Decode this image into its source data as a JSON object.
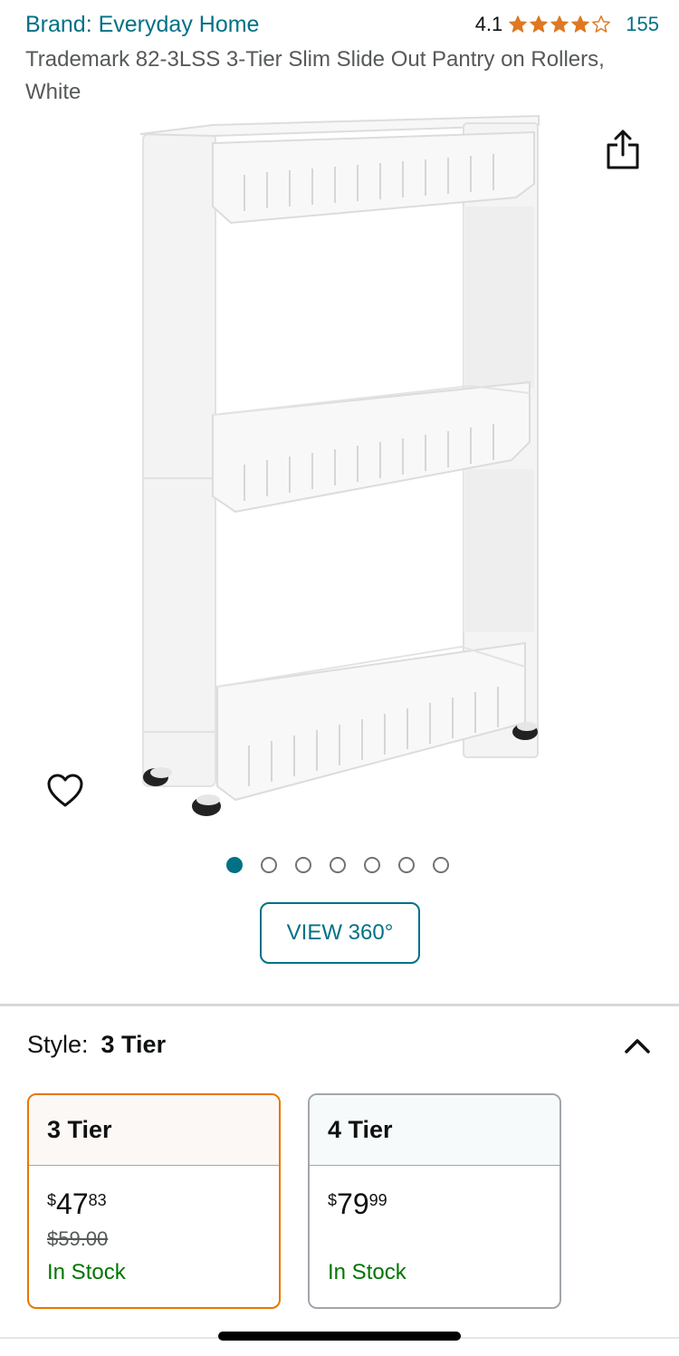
{
  "header": {
    "brand": "Brand: Everyday Home",
    "rating": "4.1",
    "stars_value": 4.1,
    "review_count": "155",
    "title": "Trademark 82-3LSS 3-Tier Slim Slide Out Pantry on Rollers, White"
  },
  "icons": {
    "share": "share-icon",
    "wishlist": "heart-icon",
    "collapse": "chevron-up-icon"
  },
  "gallery": {
    "image_alt": "3-tier slim slide out pantry cart, white",
    "dot_count": 7,
    "active_dot": 0,
    "view360_label": "VIEW 360°"
  },
  "style": {
    "label": "Style:",
    "value": "3 Tier"
  },
  "options": [
    {
      "name": "3 Tier",
      "currency": "$",
      "price_whole": "47",
      "price_fraction": "83",
      "list_price": "$59.00",
      "stock": "In Stock",
      "selected": true
    },
    {
      "name": "4 Tier",
      "currency": "$",
      "price_whole": "79",
      "price_fraction": "99",
      "list_price": "",
      "stock": "In Stock",
      "selected": false
    }
  ],
  "colors": {
    "link": "#007185",
    "star": "#de7921",
    "selected_border": "#e77600",
    "in_stock": "#007600"
  }
}
